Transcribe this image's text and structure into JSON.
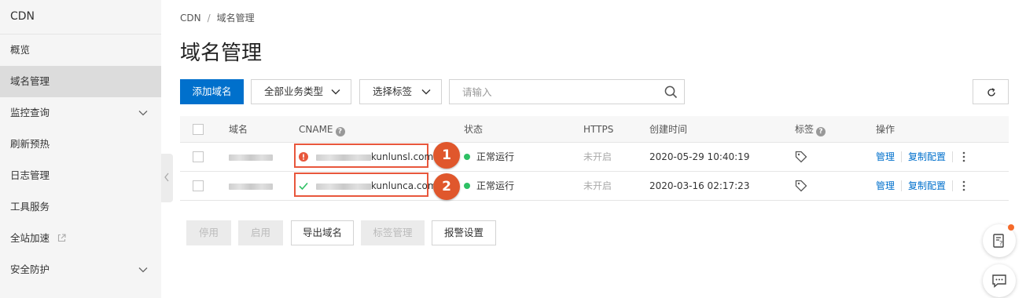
{
  "sidebar": {
    "title": "CDN",
    "items": [
      {
        "label": "概览"
      },
      {
        "label": "域名管理"
      },
      {
        "label": "监控查询"
      },
      {
        "label": "刷新预热"
      },
      {
        "label": "日志管理"
      },
      {
        "label": "工具服务"
      },
      {
        "label": "全站加速"
      },
      {
        "label": "安全防护"
      }
    ]
  },
  "breadcrumb": {
    "root": "CDN",
    "sep": "/",
    "current": "域名管理"
  },
  "page_title": "域名管理",
  "toolbar": {
    "add_domain": "添加域名",
    "business_type": "全部业务类型",
    "select_tag": "选择标签",
    "search_placeholder": "请输入"
  },
  "table": {
    "headers": {
      "domain": "域名",
      "cname": "CNAME",
      "status": "状态",
      "https": "HTTPS",
      "created": "创建时间",
      "tags": "标签",
      "actions": "操作"
    },
    "rows": [
      {
        "cname_suffix": "kunlunsl.com",
        "cname_state": "warning",
        "status": "正常运行",
        "https": "未开启",
        "created": "2020-05-29 10:40:19",
        "manage": "管理",
        "copy_config": "复制配置",
        "callout": "1"
      },
      {
        "cname_suffix": "kunlunca.com",
        "cname_state": "ok",
        "status": "正常运行",
        "https": "未开启",
        "created": "2020-03-16 02:17:23",
        "manage": "管理",
        "copy_config": "复制配置",
        "callout": "2"
      }
    ]
  },
  "bottom_actions": {
    "stop": "停用",
    "enable": "启用",
    "export": "导出域名",
    "tag_manage": "标签管理",
    "alarm": "报警设置"
  },
  "colors": {
    "primary": "#0070cc",
    "success": "#2ec064",
    "warning": "#e8573c",
    "callout": "#e0572c"
  }
}
